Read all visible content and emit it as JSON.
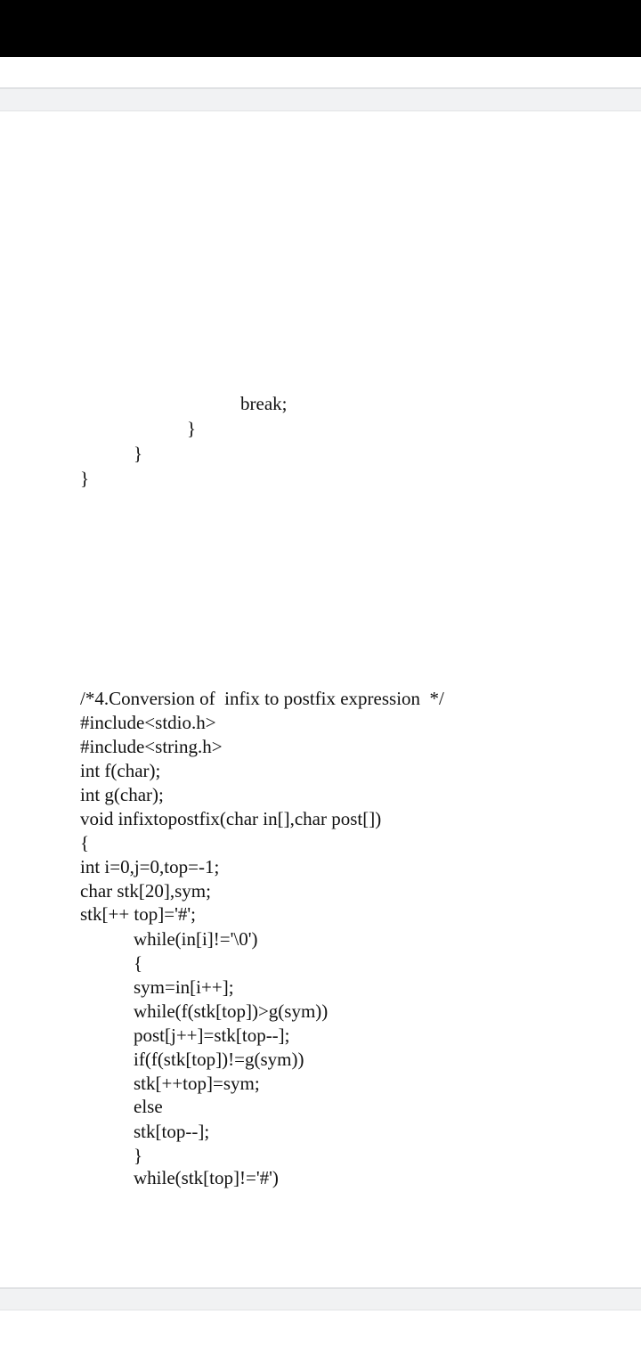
{
  "page_tail": {
    "lines": [
      "break;",
      "}",
      "}",
      "}"
    ]
  },
  "code": {
    "lines": [
      "/*4.Conversion of  infix to postfix expression  */",
      "#include<stdio.h>",
      "#include<string.h>",
      "int f(char);",
      "int g(char);",
      "void infixtopostfix(char in[],char post[])",
      "{",
      "int i=0,j=0,top=-1;",
      "char stk[20],sym;",
      "stk[++ top]='#';",
      "while(in[i]!='\\0')",
      "{",
      "sym=in[i++];",
      "while(f(stk[top])>g(sym))",
      "post[j++]=stk[top--];",
      "if(f(stk[top])!=g(sym))",
      "stk[++top]=sym;",
      "else",
      "stk[top--];",
      "}",
      "while(stk[top]!='#')"
    ]
  }
}
